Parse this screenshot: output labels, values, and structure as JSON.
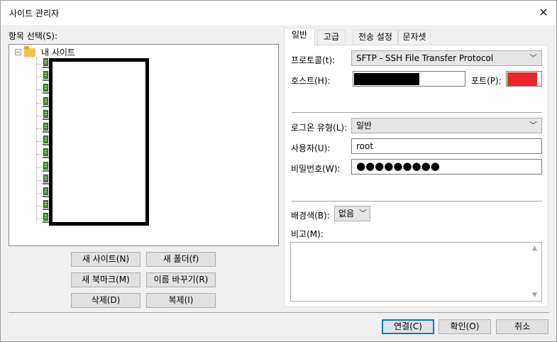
{
  "window": {
    "title": "사이트 관리자",
    "close_glyph": "✕"
  },
  "tree": {
    "label": "항목 선택(S):",
    "root": {
      "toggle": "−",
      "label": "내 사이트"
    },
    "item_count": 13
  },
  "left_buttons": {
    "new_site": "새 사이트(N)",
    "new_folder": "새 폴더(f)",
    "new_bookmark": "새 북마크(M)",
    "rename": "이름 바꾸기(R)",
    "delete": "삭제(D)",
    "duplicate": "복제(I)"
  },
  "tabs": [
    "일반",
    "고급",
    "전송 설정",
    "문자셋"
  ],
  "general": {
    "protocol_label": "프로토콜(t):",
    "protocol_value": "SFTP - SSH File Transfer Protocol",
    "host_label": "호스트(H):",
    "port_label": "포트(P):",
    "logon_label": "로그온 유형(L):",
    "logon_value": "일반",
    "user_label": "사용자(U):",
    "user_value": "root",
    "password_label": "비밀번호(W):",
    "password_value": "●●●●●●●●●",
    "bg_label": "배경색(B):",
    "bg_value": "없음",
    "memo_label": "비고(M):"
  },
  "footer": {
    "connect": "연결(C)",
    "ok": "확인(O)",
    "cancel": "취소"
  },
  "colors": {
    "port_redaction": "#e8262b",
    "host_redaction": "#000000",
    "accent": "#0078d7"
  }
}
